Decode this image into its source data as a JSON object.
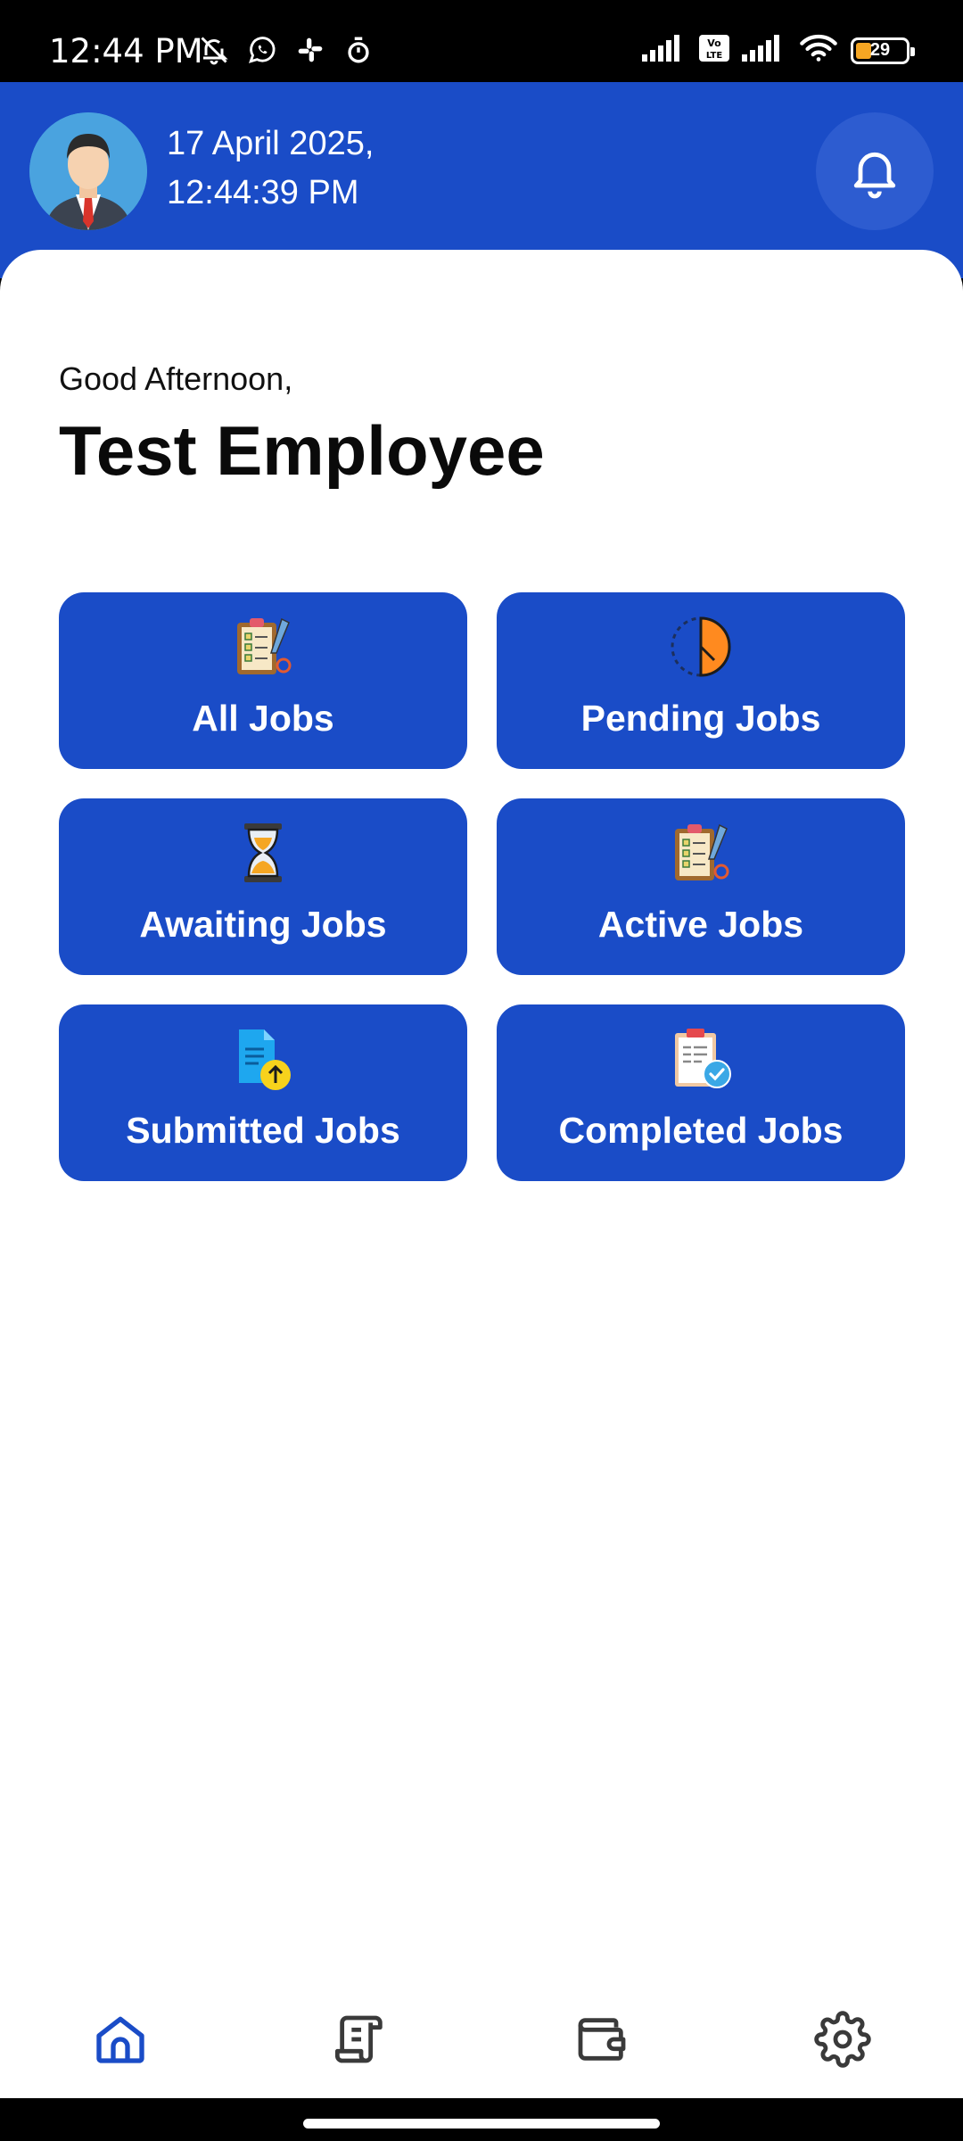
{
  "status_bar": {
    "time": "12:44 PM",
    "battery": "29",
    "left_icons": [
      "mute-bell-icon",
      "whatsapp-icon",
      "slack-icon",
      "timer-icon"
    ],
    "right_icons": [
      "signal-icon",
      "volte-icon",
      "signal-2-icon",
      "wifi-icon",
      "battery-icon"
    ]
  },
  "header": {
    "date": "17 April 2025,",
    "time": "12:44:39 PM",
    "avatar": "employee-avatar",
    "notification_icon": "bell-icon"
  },
  "greeting": {
    "salutation": "Good Afternoon,",
    "name": "Test Employee"
  },
  "tiles": [
    {
      "label": "All Jobs",
      "icon": "clipboard-checklist-icon"
    },
    {
      "label": "Pending Jobs",
      "icon": "half-clock-icon"
    },
    {
      "label": "Awaiting Jobs",
      "icon": "hourglass-icon"
    },
    {
      "label": "Active Jobs",
      "icon": "clipboard-checklist-icon"
    },
    {
      "label": "Submitted Jobs",
      "icon": "document-upload-icon"
    },
    {
      "label": "Completed Jobs",
      "icon": "clipboard-check-icon"
    }
  ],
  "bottom_nav": [
    {
      "name": "home",
      "icon": "home-icon",
      "active": true
    },
    {
      "name": "jobs",
      "icon": "scroll-icon",
      "active": false
    },
    {
      "name": "wallet",
      "icon": "wallet-icon",
      "active": false
    },
    {
      "name": "settings",
      "icon": "gear-icon",
      "active": false
    }
  ],
  "colors": {
    "primary": "#1a4cc7",
    "nav_active": "#1a4cc7",
    "nav_inactive": "#3a3a3a",
    "pending_orange": "#ff8a1f",
    "submitted_blue": "#1ea7ef",
    "submitted_badge": "#f7d21c"
  }
}
